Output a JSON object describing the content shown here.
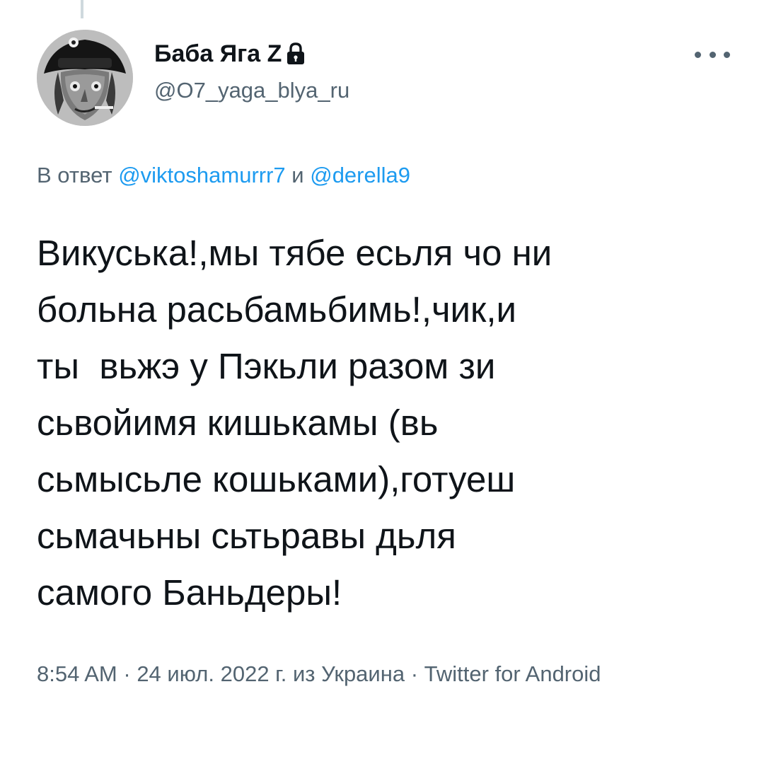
{
  "author": {
    "display_name": "Баба Яга Z",
    "handle": "@O7_yaga_blya_ru",
    "avatar_icon": "avatar-image",
    "lock_icon": "lock-icon"
  },
  "menu": {
    "more_icon": "more-horizontal-icon"
  },
  "reply": {
    "prefix": "В ответ ",
    "user1": "@viktoshamurrr7",
    "conjunction": " и ",
    "user2": "@derella9"
  },
  "tweet": {
    "lines": [
      "Викуська!,мы тябе есьля чо ни",
      "больна расьбамьбимь!,чик,и",
      "ты  вьжэ у Пэкьли разом зи",
      "сьвойимя кишькамы (вь",
      "сьмысьле кошьками),готуеш",
      "сьмачьны сьтьравы дьля",
      "самого Баньдеры!"
    ]
  },
  "meta": {
    "time": "8:54 AM",
    "separator": " · ",
    "date": "24 июл. 2022 г.",
    "location": " из Украина",
    "source": "Twitter for Android"
  },
  "colors": {
    "text": "#0f1419",
    "secondary": "#536471",
    "link": "#1d9bf0"
  }
}
